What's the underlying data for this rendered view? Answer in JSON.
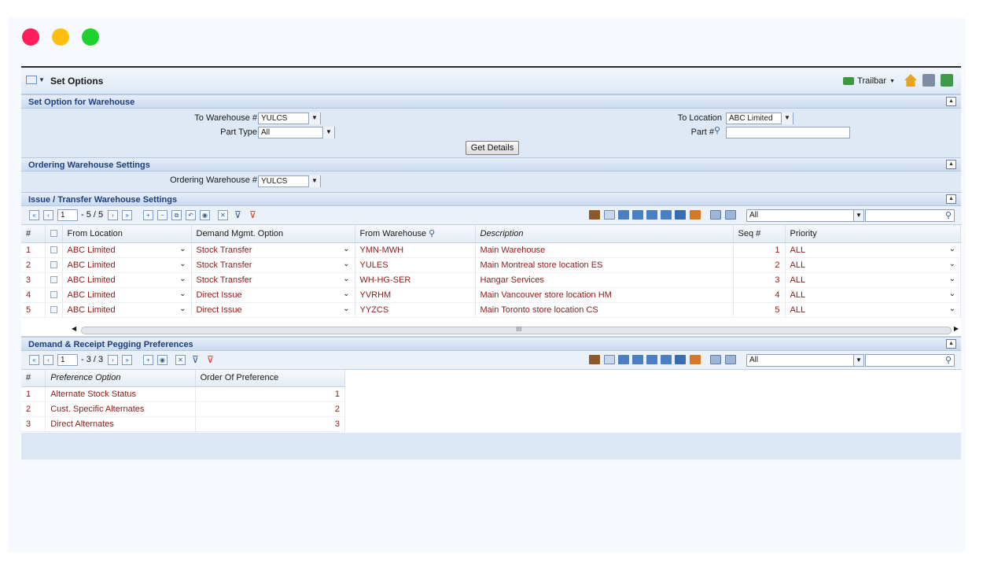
{
  "window": {
    "title": "Set Options",
    "trailbar_label": "Trailbar"
  },
  "section1": {
    "title": "Set Option for Warehouse",
    "to_warehouse_label": "To Warehouse #",
    "to_warehouse_value": "YULCS",
    "part_type_label": "Part Type",
    "part_type_value": "All",
    "to_location_label": "To Location",
    "to_location_value": "ABC Limited",
    "part_label": "Part #",
    "part_value": "",
    "get_details_label": "Get Details"
  },
  "section2": {
    "title": "Ordering Warehouse Settings",
    "ordering_warehouse_label": "Ordering Warehouse #",
    "ordering_warehouse_value": "YULCS"
  },
  "section3": {
    "title": "Issue / Transfer Warehouse Settings",
    "page_current": "1",
    "page_total": "- 5 / 5",
    "filter_value": "All",
    "columns": [
      "#",
      "From Location",
      "Demand Mgmt. Option",
      "From Warehouse",
      "Description",
      "Seq #",
      "Priority"
    ],
    "rows": [
      {
        "n": "1",
        "from_location": "ABC Limited",
        "demand": "Stock Transfer",
        "from_wh": "YMN-MWH",
        "desc": "Main Warehouse",
        "seq": "1",
        "priority": "ALL"
      },
      {
        "n": "2",
        "from_location": "ABC Limited",
        "demand": "Stock Transfer",
        "from_wh": "YULES",
        "desc": "Main Montreal store location ES",
        "seq": "2",
        "priority": "ALL"
      },
      {
        "n": "3",
        "from_location": "ABC Limited",
        "demand": "Stock Transfer",
        "from_wh": "WH-HG-SER",
        "desc": "Hangar Services",
        "seq": "3",
        "priority": "ALL"
      },
      {
        "n": "4",
        "from_location": "ABC Limited",
        "demand": "Direct Issue",
        "from_wh": "YVRHM",
        "desc": "Main Vancouver store location HM",
        "seq": "4",
        "priority": "ALL"
      },
      {
        "n": "5",
        "from_location": "ABC Limited",
        "demand": "Direct Issue",
        "from_wh": "YYZCS",
        "desc": "Main Toronto store location  CS",
        "seq": "5",
        "priority": "ALL"
      }
    ],
    "scroll_mark": "III"
  },
  "section4": {
    "title": "Demand & Receipt Pegging Preferences",
    "page_current": "1",
    "page_total": "- 3 / 3",
    "filter_value": "All",
    "columns": [
      "#",
      "Preference Option",
      "Order Of Preference"
    ],
    "rows": [
      {
        "n": "1",
        "option": "Alternate Stock Status",
        "order": "1"
      },
      {
        "n": "2",
        "option": "Cust. Specific Alternates",
        "order": "2"
      },
      {
        "n": "3",
        "option": "Direct Alternates",
        "order": "3"
      }
    ]
  }
}
